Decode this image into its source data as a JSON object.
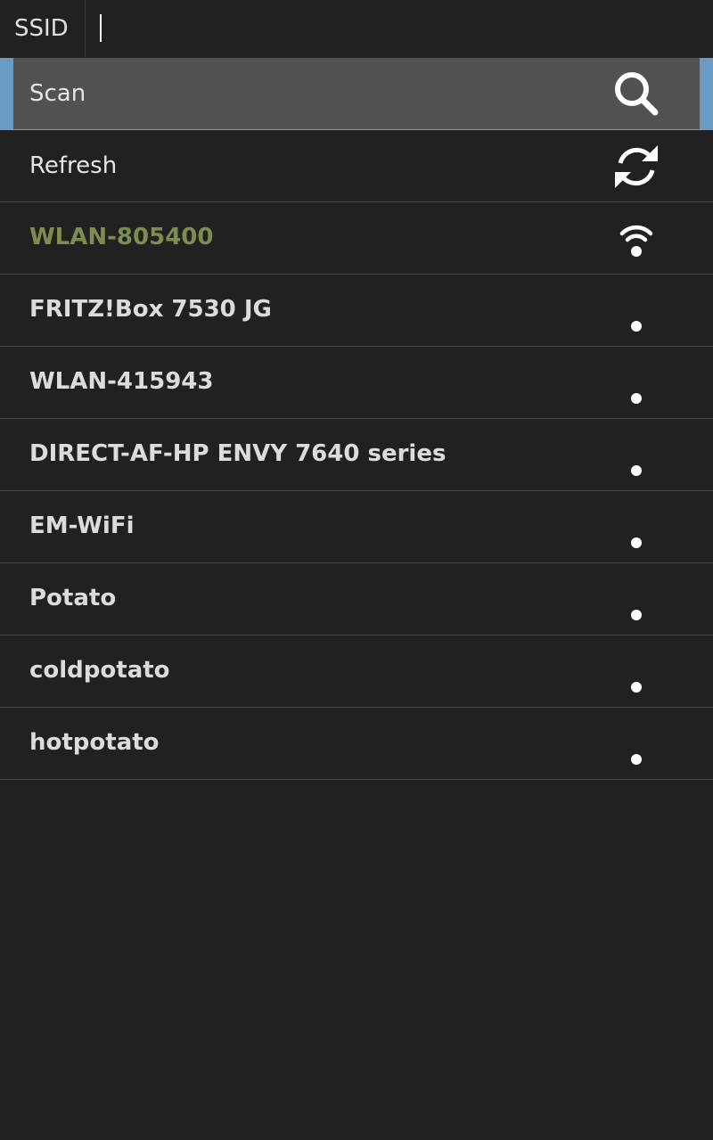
{
  "header": {
    "ssid_label": "SSID",
    "ssid_value": ""
  },
  "actions": {
    "scan_label": "Scan",
    "scan_icon": "search-icon",
    "refresh_label": "Refresh",
    "refresh_icon": "refresh-icon"
  },
  "colors": {
    "background": "#212121",
    "selected_accent": "#6a9dc5",
    "selected_fill": "#515151",
    "connected_text": "#7b8e4d"
  },
  "networks": [
    {
      "ssid": "WLAN-805400",
      "connected": true,
      "icon": "wifi-signal-icon"
    },
    {
      "ssid": "FRITZ!Box 7530 JG",
      "connected": false,
      "icon": "weak-signal-dot-icon"
    },
    {
      "ssid": "WLAN-415943",
      "connected": false,
      "icon": "weak-signal-dot-icon"
    },
    {
      "ssid": "DIRECT-AF-HP ENVY 7640 series",
      "connected": false,
      "icon": "weak-signal-dot-icon"
    },
    {
      "ssid": "EM-WiFi",
      "connected": false,
      "icon": "weak-signal-dot-icon"
    },
    {
      "ssid": "Potato",
      "connected": false,
      "icon": "weak-signal-dot-icon"
    },
    {
      "ssid": "coldpotato",
      "connected": false,
      "icon": "weak-signal-dot-icon"
    },
    {
      "ssid": "hotpotato",
      "connected": false,
      "icon": "weak-signal-dot-icon"
    }
  ]
}
